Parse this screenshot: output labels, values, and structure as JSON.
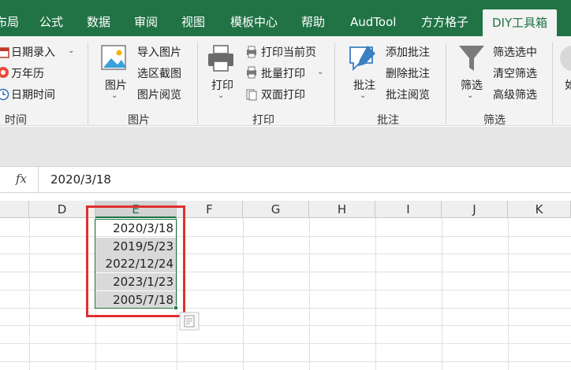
{
  "tabs": [
    "布局",
    "公式",
    "数据",
    "审阅",
    "视图",
    "模板中心",
    "帮助",
    "AudTool",
    "方方格子",
    "DIY工具箱"
  ],
  "ribbon": {
    "time_group": {
      "items": [
        "日期录入",
        "万年历",
        "日期时间"
      ],
      "title": "时间"
    },
    "image_group": {
      "big_button": "图片",
      "items": [
        "导入图片",
        "选区截图",
        "图片阅览"
      ],
      "title": "图片"
    },
    "print_group": {
      "big_button": "打印",
      "items": [
        "打印当前页",
        "批量打印",
        "双面打印"
      ],
      "title": "打印"
    },
    "comment_group": {
      "big_button": "批注",
      "items": [
        "添加批注",
        "删除批注",
        "批注阅览"
      ],
      "title": "批注"
    },
    "filter_group": {
      "big_button": "筛选",
      "items": [
        "筛选选中",
        "清空筛选",
        "高级筛选"
      ],
      "title": "筛选"
    },
    "cut_label": "如"
  },
  "formula_bar": {
    "fx_label": "fx",
    "value": "2020/3/18"
  },
  "columns": [
    "D",
    "E",
    "F",
    "G",
    "H",
    "I",
    "J",
    "K"
  ],
  "cells_E": [
    "2020/3/18",
    "2019/5/23",
    "2022/12/24",
    "2023/1/23",
    "2005/7/18"
  ],
  "colors": {
    "accent_green": "#217346",
    "highlight_red": "#e03030",
    "selection_gray": "#d9d9d9"
  }
}
